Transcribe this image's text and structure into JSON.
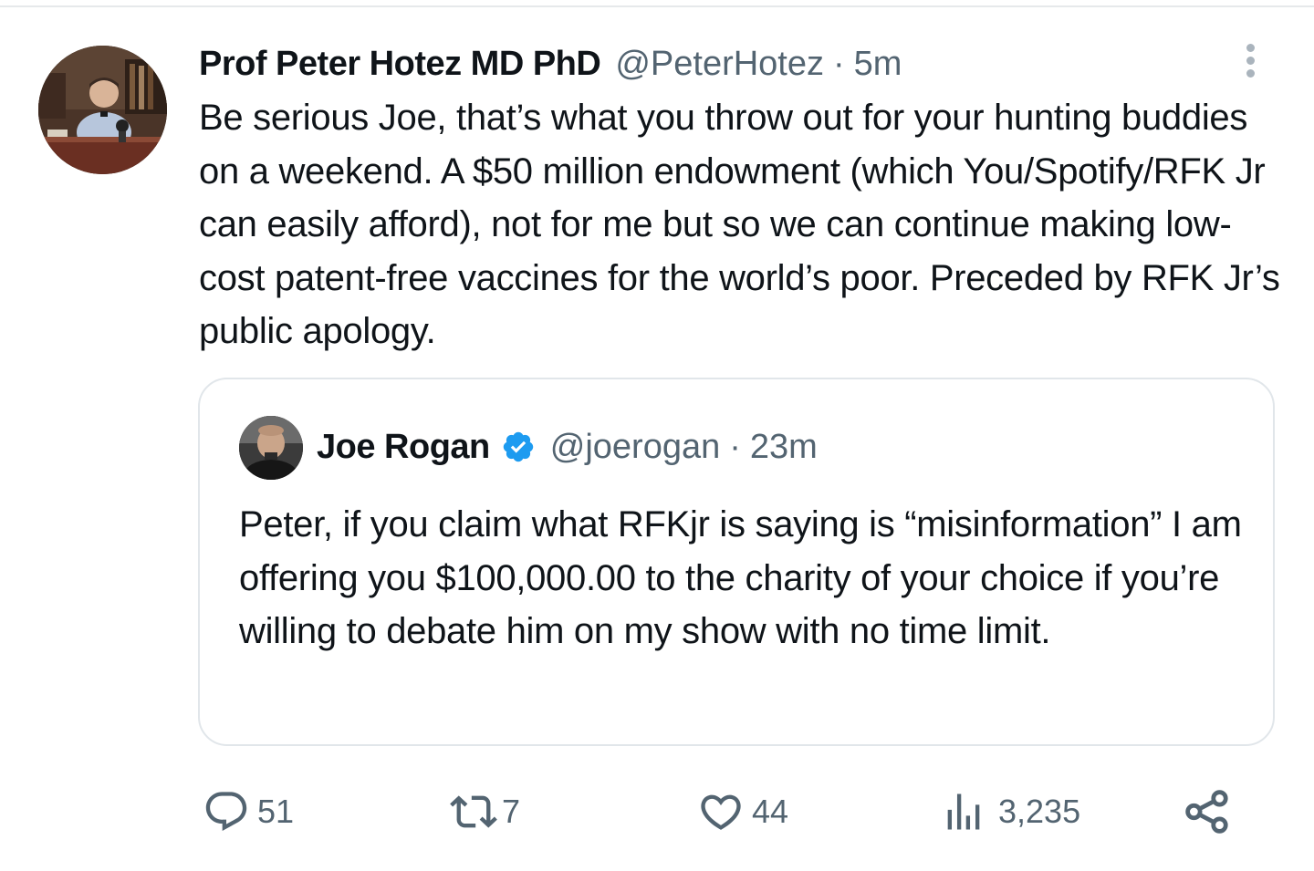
{
  "tweet": {
    "author": {
      "name": "Prof Peter Hotez MD PhD",
      "handle": "@PeterHotez",
      "time": "5m"
    },
    "separator": "·",
    "text": "Be serious Joe, that’s what you throw out for your hunting buddies on a weekend. A $50 million endowment (which You/Spotify/RFK Jr can easily afford), not for me but so we can continue making low-cost patent-free vaccines for the world’s poor. Preceded by RFK Jr’s public apology.",
    "quoted": {
      "name": "Joe Rogan",
      "handle": "@joerogan",
      "time": "23m",
      "verified": true,
      "text": "Peter, if you claim what RFKjr is saying is “misinformation” I am offering you $100,000.00 to the charity of your choice if you’re willing to debate him on my show with no time limit."
    },
    "actions": {
      "replies": "51",
      "retweets": "7",
      "likes": "44",
      "views": "3,235"
    }
  },
  "colors": {
    "text_primary": "#0f1419",
    "text_secondary": "#536471",
    "verified_blue": "#1d9bf0",
    "card_border": "#e1e6ea"
  },
  "icons": [
    "more-icon",
    "verified-badge-icon",
    "reply-icon",
    "retweet-icon",
    "like-icon",
    "views-icon",
    "share-icon"
  ]
}
